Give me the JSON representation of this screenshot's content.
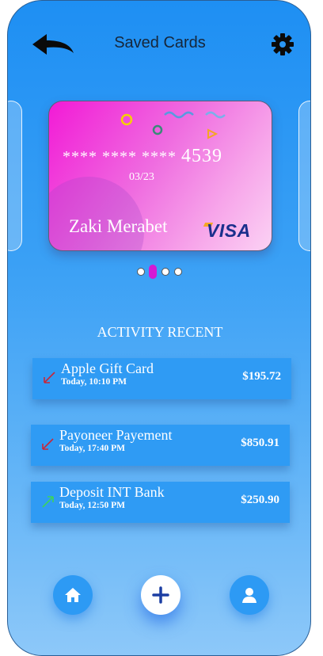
{
  "header": {
    "title": "Saved Cards",
    "back_icon": "arrow-back-icon",
    "settings_icon": "gear-icon"
  },
  "card": {
    "masked_number": "**** **** ****",
    "last_digits": "4539",
    "expiry": "03/23",
    "holder": "Zaki Merabet",
    "brand": "VISA",
    "gradient_colors": [
      "#f21ad6",
      "#fbd2f4"
    ]
  },
  "carousel": {
    "count": 4,
    "active_index": 1,
    "active_color": "#d41ad4"
  },
  "activity": {
    "title": "ACTIVITY RECENT",
    "items": [
      {
        "name": "Apple Gift Card",
        "time": "Today, 10:10 PM",
        "amount": "$195.72",
        "direction": "out",
        "icon": "arrow-down-left-icon",
        "icon_color": "#c8283a"
      },
      {
        "name": "Payoneer Payement",
        "time": "Today, 17:40 PM",
        "amount": "$850.91",
        "direction": "out",
        "icon": "arrow-down-left-icon",
        "icon_color": "#c8283a"
      },
      {
        "name": "Deposit INT Bank",
        "time": "Today, 12:50 PM",
        "amount": "$250.90",
        "direction": "in",
        "icon": "arrow-up-right-icon",
        "icon_color": "#3cd45a"
      }
    ]
  },
  "bottom_nav": {
    "items": [
      {
        "icon": "home-icon"
      },
      {
        "icon": "plus-icon"
      },
      {
        "icon": "user-icon"
      }
    ]
  },
  "colors": {
    "background_top": "#1e8ff3",
    "background_bottom": "#8dc8f9",
    "row_bg": "#2f9bf4",
    "brand_blue": "#1a2f8c"
  }
}
